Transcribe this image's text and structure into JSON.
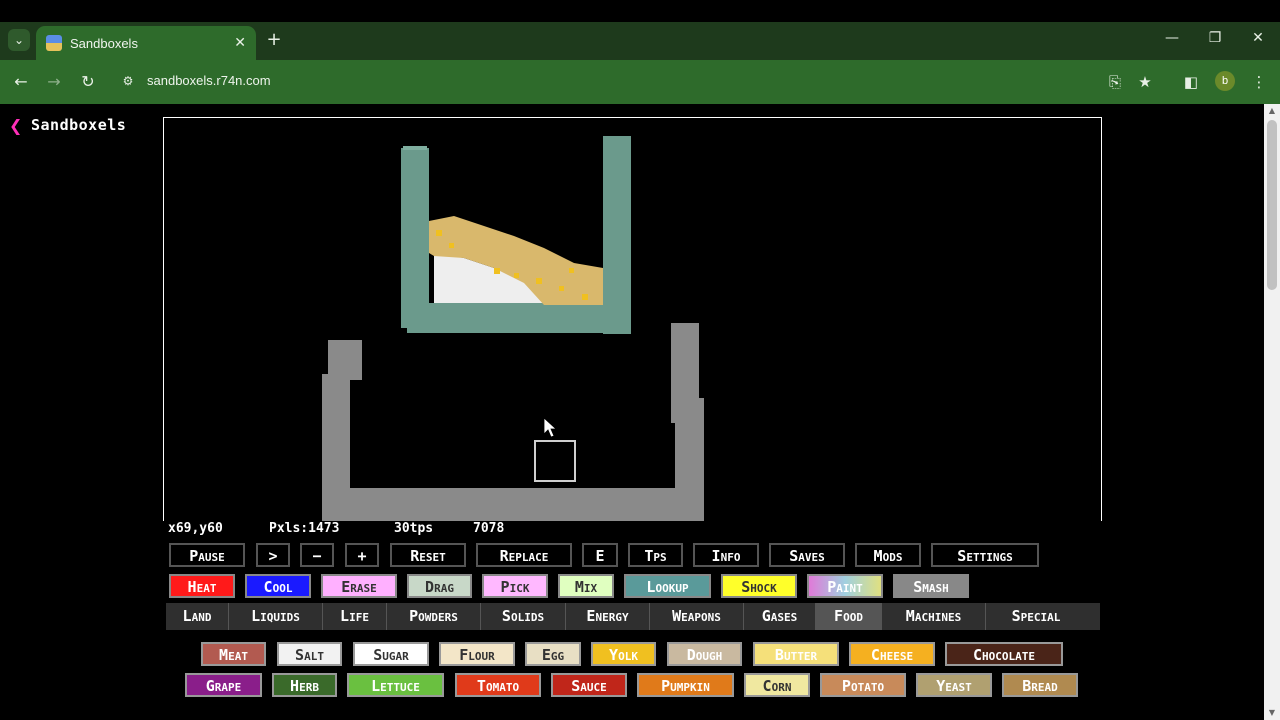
{
  "browser": {
    "tab_title": "Sandboxels",
    "url": "sandboxels.r74n.com",
    "profile_initial": "b"
  },
  "page": {
    "title": "Sandboxels"
  },
  "stats": {
    "coords": "x69,y60",
    "pixels": "Pxls:1473",
    "tps": "30tps",
    "ticks": "7078"
  },
  "controls": [
    "Pause",
    ">",
    "−",
    "+",
    "Reset",
    "Replace",
    "E",
    "Tps",
    "Info",
    "Saves",
    "Mods",
    "Settings"
  ],
  "tools": [
    {
      "label": "Heat",
      "color": "#ff1a1a"
    },
    {
      "label": "Cool",
      "color": "#1a1aff"
    },
    {
      "label": "Erase",
      "color": "#ffb0ff"
    },
    {
      "label": "Drag",
      "color": "#c8d8c8"
    },
    {
      "label": "Pick",
      "color": "#ffb8ff"
    },
    {
      "label": "Mix",
      "color": "#e0ffc0"
    },
    {
      "label": "Lookup",
      "color": "#5a9a9a"
    },
    {
      "label": "Shock",
      "color": "#ffff2a"
    },
    {
      "label": "Paint",
      "color": "#cc88ee"
    },
    {
      "label": "Smash",
      "color": "#888888"
    }
  ],
  "categories": [
    "Land",
    "Liquids",
    "Life",
    "Powders",
    "Solids",
    "Energy",
    "Weapons",
    "Gases",
    "Food",
    "Machines",
    "Special"
  ],
  "selected_category": "Food",
  "elements_row1": [
    {
      "label": "Meat",
      "color": "#b25a50"
    },
    {
      "label": "Salt",
      "color": "#f2f2f2"
    },
    {
      "label": "Sugar",
      "color": "#ffffff"
    },
    {
      "label": "Flour",
      "color": "#f3e6c8"
    },
    {
      "label": "Egg",
      "color": "#e8dfc4"
    },
    {
      "label": "Yolk",
      "color": "#f0c020"
    },
    {
      "label": "Dough",
      "color": "#c9b9a0"
    },
    {
      "label": "Butter",
      "color": "#f5e07a"
    },
    {
      "label": "Cheese",
      "color": "#f5b020"
    },
    {
      "label": "Chocolate",
      "color": "#4a2418"
    }
  ],
  "elements_row2": [
    {
      "label": "Grape",
      "color": "#8a1e8a"
    },
    {
      "label": "Herb",
      "color": "#3a6a2a"
    },
    {
      "label": "Lettuce",
      "color": "#6ac040"
    },
    {
      "label": "Tomato",
      "color": "#e03a1a"
    },
    {
      "label": "Sauce",
      "color": "#c0261a"
    },
    {
      "label": "Pumpkin",
      "color": "#e07a1a"
    },
    {
      "label": "Corn",
      "color": "#f0e8a0"
    },
    {
      "label": "Potato",
      "color": "#c88a5a"
    },
    {
      "label": "Yeast",
      "color": "#b0a070"
    },
    {
      "label": "Bread",
      "color": "#b08a50"
    }
  ]
}
